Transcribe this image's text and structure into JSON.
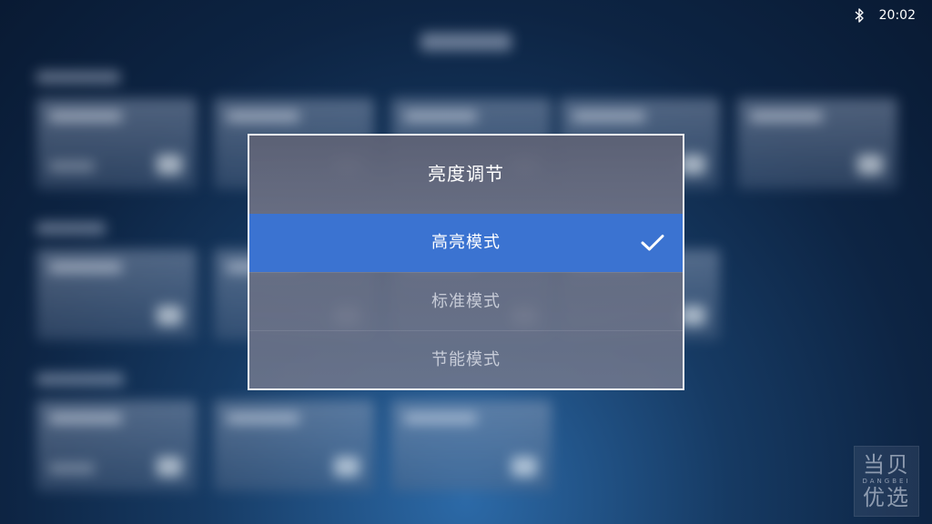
{
  "status_bar": {
    "bluetooth_icon": "bluetooth-icon",
    "time": "20:02"
  },
  "dialog": {
    "title": "亮度调节",
    "options": [
      {
        "label": "高亮模式",
        "selected": true
      },
      {
        "label": "标准模式",
        "selected": false
      },
      {
        "label": "节能模式",
        "selected": false
      }
    ],
    "selected_icon": "check-icon"
  },
  "watermark": {
    "line1": "当贝",
    "line2": "DANGBEI",
    "line3": "优选"
  },
  "colors": {
    "selected_option": "#3b73d1",
    "dialog_border": "#ffffff",
    "background_dark": "#0d2443"
  }
}
